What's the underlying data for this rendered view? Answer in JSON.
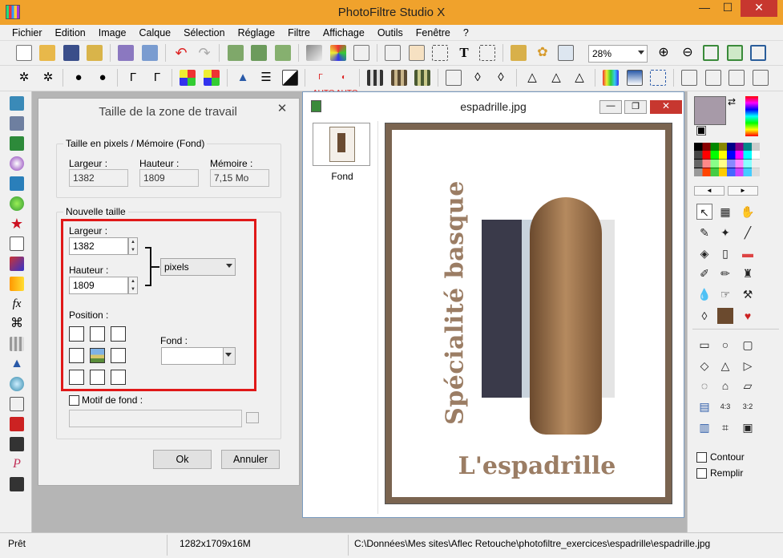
{
  "window": {
    "title": "PhotoFiltre Studio X",
    "minimize": "—",
    "maximize": "☐",
    "close": "✕"
  },
  "menu": [
    "Fichier",
    "Edition",
    "Image",
    "Calque",
    "Sélection",
    "Réglage",
    "Filtre",
    "Affichage",
    "Outils",
    "Fenêtre",
    "?"
  ],
  "toolbar": {
    "zoom": "28%"
  },
  "dialog": {
    "title": "Taille de la zone de travail",
    "close": "✕",
    "group1_title": "Taille en pixels / Mémoire (Fond)",
    "width_label": "Largeur :",
    "height_label": "Hauteur :",
    "memory_label": "Mémoire :",
    "width_value": "1382",
    "height_value": "1809",
    "memory_value": "7,15 Mo",
    "group2_title": "Nouvelle taille",
    "new_width_label": "Largeur :",
    "new_width_value": "1382",
    "new_height_label": "Hauteur :",
    "new_height_value": "1809",
    "unit": "pixels",
    "position_label": "Position :",
    "fond_label": "Fond :",
    "fond_value": "",
    "motif_label": "Motif de fond :",
    "motif_value": "",
    "ok_label": "Ok",
    "cancel_label": "Annuler"
  },
  "image_window": {
    "title": "espadrille.jpg",
    "layer_name": "Fond",
    "vertical_text": "Spécialité basque",
    "bottom_text": "L'espadrille"
  },
  "right_panel": {
    "contour_label": "Contour",
    "remplir_label": "Remplir"
  },
  "status": {
    "state": "Prêt",
    "size": "1282x1709x16M",
    "path": "C:\\Données\\Mes sites\\Aflec Retouche\\photofiltre_exercices\\espadrille\\espadrille.jpg"
  },
  "colors": {
    "title_bar": "#f0a22c",
    "highlight_box": "#e01818",
    "foreground": "#a79aa8",
    "background": "#ffffff"
  }
}
